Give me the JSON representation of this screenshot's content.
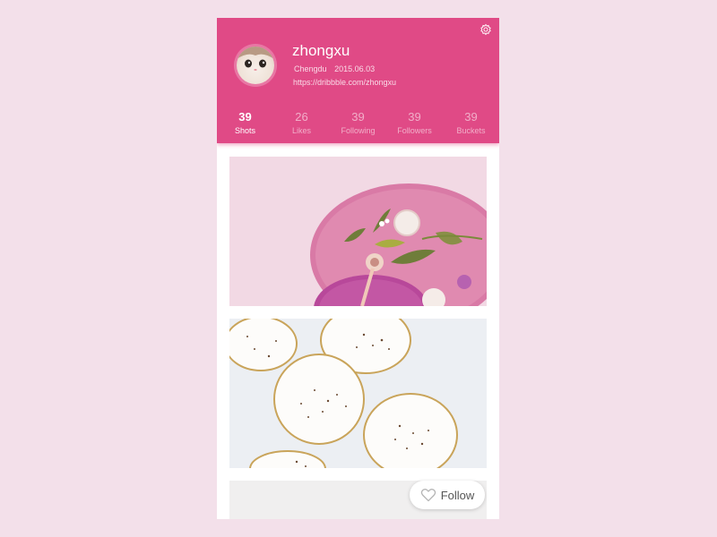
{
  "profile": {
    "username": "zhongxu",
    "location": "Chengdu",
    "joined": "2015.06.03",
    "url": "https://dribbble.com/zhongxu",
    "avatar_icon": "cat-avatar"
  },
  "header": {
    "settings_icon": "gear-icon",
    "brand_color": "#e04a86"
  },
  "stats": [
    {
      "value": "39",
      "label": "Shots",
      "active": true
    },
    {
      "value": "26",
      "label": "Likes",
      "active": false
    },
    {
      "value": "39",
      "label": "Following",
      "active": false
    },
    {
      "value": "39",
      "label": "Followers",
      "active": false
    },
    {
      "value": "39",
      "label": "Buckets",
      "active": false
    }
  ],
  "shots": [
    {
      "subject": "pink plates with leaves and cosmetics"
    },
    {
      "subject": "white speckled plates with gold rims"
    },
    {
      "subject": "partially visible shot"
    }
  ],
  "follow_button": {
    "label": "Follow",
    "icon": "heart-icon"
  },
  "background_color": "#f3e0ea"
}
